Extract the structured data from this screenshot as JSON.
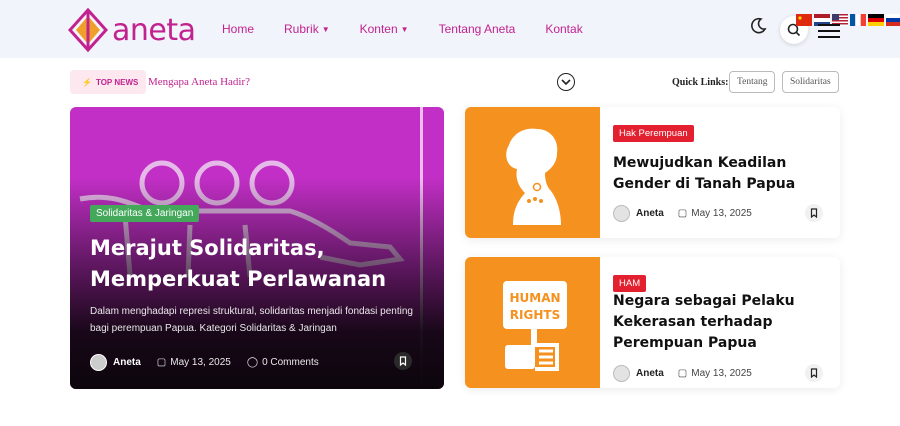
{
  "brand": {
    "name": "aneta",
    "accent": "#c2228f"
  },
  "nav": {
    "items": [
      {
        "label": "Home",
        "dropdown": false
      },
      {
        "label": "Rubrik",
        "dropdown": true
      },
      {
        "label": "Konten",
        "dropdown": true
      },
      {
        "label": "Tentang Aneta",
        "dropdown": false
      },
      {
        "label": "Kontak",
        "dropdown": false
      }
    ]
  },
  "header_icons": [
    "moon-icon",
    "search-icon",
    "menu-icon"
  ],
  "ticker": {
    "pill_label": "TOP NEWS",
    "headline": "Mengapa Aneta Hadir?",
    "quick_links_label": "Quick Links:",
    "quick_links": [
      "Tentang",
      "Solidaritas"
    ]
  },
  "hero": {
    "category": "Solidaritas & Jaringan",
    "title": "Merajut Solidaritas, Memperkuat Perlawanan",
    "description": "Dalam menghadapi represi struktural, solidaritas menjadi fondasi penting bagi perempuan Papua. Kategori Solidaritas & Jaringan",
    "author": "Aneta",
    "date": "May 13, 2025",
    "comments": "0 Comments"
  },
  "cards": [
    {
      "tag": "Hak Perempuan",
      "title": "Mewujudkan Keadilan Gender di Tanah Papua",
      "author": "Aneta",
      "date": "May 13, 2025"
    },
    {
      "tag": "HAM",
      "title": "Negara sebagai Pelaku Kekerasan terhadap Perempuan Papua",
      "author": "Aneta",
      "date": "May 13, 2025",
      "image_text": [
        "HUMAN",
        "RIGHTS"
      ]
    }
  ]
}
